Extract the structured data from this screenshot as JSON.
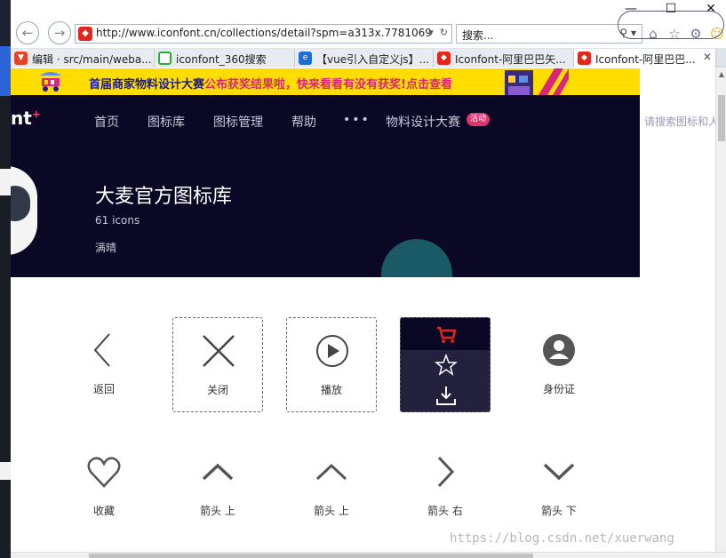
{
  "browser": {
    "url": "http://www.iconfont.cn/collections/detail?spm=a313x.7781069",
    "search_placeholder": "搜索...",
    "tabs": [
      {
        "label": "编辑 · src/main/weba...",
        "icon": "gitlab-icon",
        "color": "#e24329"
      },
      {
        "label": "iconfont_360搜索",
        "icon": "360-search-icon",
        "color": "#25b03a"
      },
      {
        "label": "【vue引入自定义js】...",
        "icon": "ie-icon",
        "color": "#1e6fd0"
      },
      {
        "label": "Iconfont-阿里巴巴矢...",
        "icon": "iconfont-icon",
        "color": "#e2261b"
      },
      {
        "label": "Iconfont-阿里巴巴...",
        "icon": "iconfont-icon",
        "color": "#e2261b",
        "active": true
      }
    ],
    "window_controls": [
      "—",
      "☐",
      "✕"
    ]
  },
  "banner": {
    "text_main": "首届商家物料设计大赛",
    "text_highlight": "公布获奖结果啦，快来看看有没有获奖!",
    "text_link": "点击查看"
  },
  "header": {
    "logo": "nt",
    "nav": [
      "首页",
      "图标库",
      "图标管理",
      "帮助",
      "•••",
      "物料设计大赛"
    ],
    "badge": "活动",
    "search_placeholder": "请搜索图标和人",
    "title": "大麦官方图标库",
    "count": "61 icons",
    "author": "满晴"
  },
  "icons": [
    {
      "label": "返回",
      "icon": "chevron-left-icon"
    },
    {
      "label": "关闭",
      "icon": "close-icon"
    },
    {
      "label": "播放",
      "icon": "play-icon"
    },
    {
      "label": "",
      "icon": "hover-actions"
    },
    {
      "label": "身份证",
      "icon": "user-avatar-icon"
    },
    {
      "label": "收藏",
      "icon": "heart-icon"
    },
    {
      "label": "箭头 上",
      "icon": "chevron-up-icon"
    },
    {
      "label": "箭头 上",
      "icon": "chevron-up-icon"
    },
    {
      "label": "箭头 右",
      "icon": "chevron-right-icon"
    },
    {
      "label": "箭头 下",
      "icon": "chevron-down-icon"
    }
  ],
  "watermark": "https://blog.csdn.net/xuerwang",
  "colors": {
    "header_bg": "#0b0826",
    "banner_bg": "#ffdd00",
    "badge": "#e0346d",
    "cart_red": "#e2261b"
  }
}
